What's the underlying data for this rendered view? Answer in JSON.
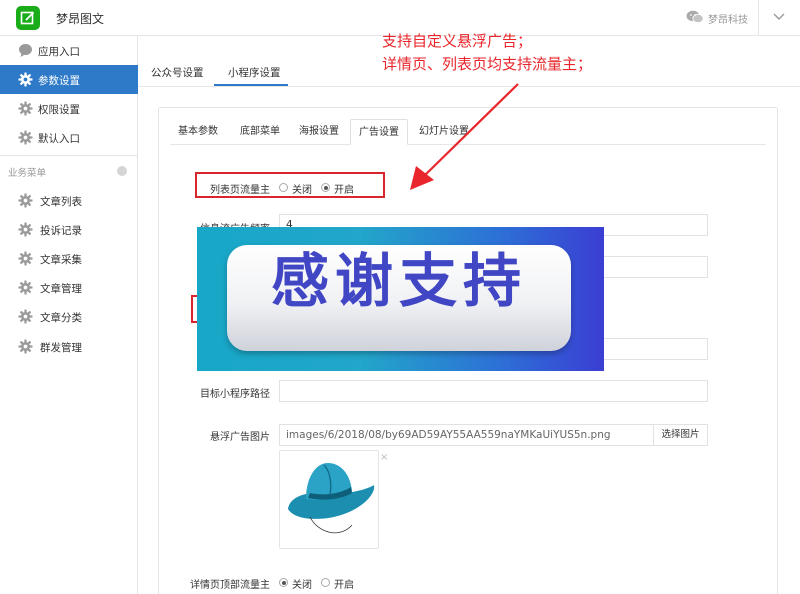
{
  "topbar": {
    "app_title": "梦昂图文",
    "company": "梦昂科技",
    "icons": {
      "logo": "edit-logo-icon",
      "wechat": "wechat-icon",
      "menu": "chevron-down-icon"
    }
  },
  "sidebar": {
    "top_items": [
      {
        "label": "应用入口",
        "icon": "chat-bubble-icon",
        "active": false
      },
      {
        "label": "参数设置",
        "icon": "gear-icon",
        "active": true
      },
      {
        "label": "权限设置",
        "icon": "gear-icon",
        "active": false
      },
      {
        "label": "默认入口",
        "icon": "gear-icon",
        "active": false
      }
    ],
    "section_title": "业务菜单",
    "biz_items": [
      {
        "label": "文章列表",
        "icon": "gear-icon"
      },
      {
        "label": "投诉记录",
        "icon": "gear-icon"
      },
      {
        "label": "文章采集",
        "icon": "gear-icon"
      },
      {
        "label": "文章管理",
        "icon": "gear-icon"
      },
      {
        "label": "文章分类",
        "icon": "gear-icon"
      },
      {
        "label": "群发管理",
        "icon": "gear-icon"
      }
    ]
  },
  "main": {
    "tabs": [
      {
        "label": "公众号设置",
        "active": false
      },
      {
        "label": "小程序设置",
        "active": true
      }
    ]
  },
  "panel": {
    "sub_tabs": [
      {
        "label": "基本参数",
        "active": false
      },
      {
        "label": "底部菜单",
        "active": false
      },
      {
        "label": "海报设置",
        "active": false
      },
      {
        "label": "广告设置",
        "active": true
      },
      {
        "label": "幻灯片设置",
        "active": false
      }
    ],
    "form": {
      "list_host_label": "列表页流量主",
      "radio_off": "关闭",
      "radio_on": "开启",
      "list_host_value": "开启",
      "feed_freq_label": "信息流广告频率",
      "feed_freq_value": "4",
      "target_path_label": "目标小程序路径",
      "target_path_value": "",
      "float_image_label": "悬浮广告图片",
      "float_image_value": "images/6/2018/08/by69AD59AY55AA559naYMKaUiYUS5n.png",
      "choose_button": "选择图片",
      "remove_mark": "×",
      "detail_top_label": "详情页顶部流量主",
      "detail_top_value": "关闭"
    }
  },
  "annotation": {
    "line1": "支持自定义悬浮广告；",
    "line2": "详情页、列表页均支持流量主；",
    "color": "#e8262b"
  },
  "banner": {
    "text": "感谢支持"
  },
  "colors": {
    "accent": "#2f7ac8",
    "brand_green": "#1aad19",
    "annotation_red": "#d9262c"
  }
}
